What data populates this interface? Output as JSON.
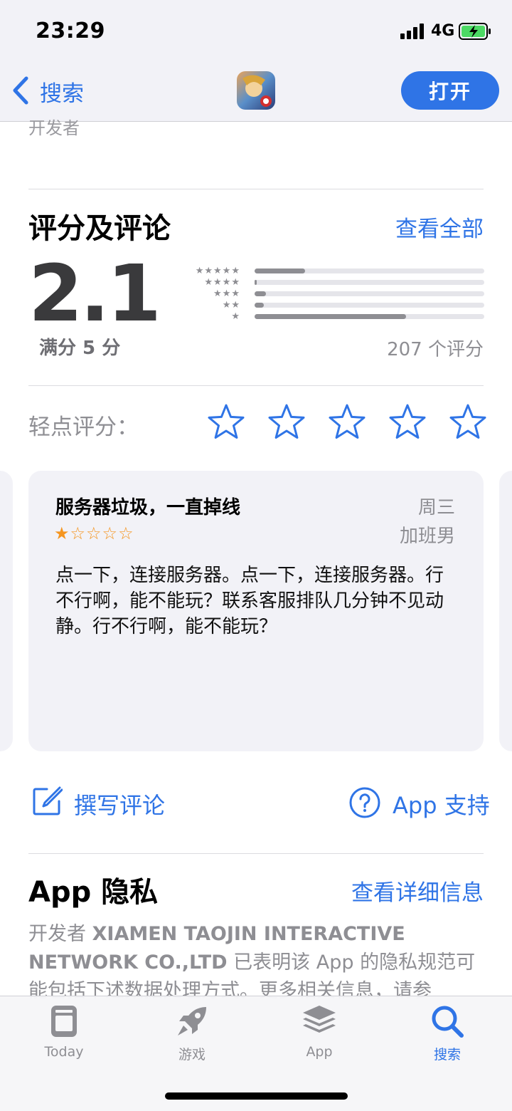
{
  "status": {
    "time": "23:29",
    "network": "4G"
  },
  "nav": {
    "back_label": "搜索",
    "open_label": "打开"
  },
  "top_cut_text": "开发者",
  "ratings": {
    "title": "评分及评论",
    "see_all": "查看全部",
    "average": "2.1",
    "out_of": "满分 5 分",
    "count": "207 个评分",
    "distribution": [
      {
        "stars": "★★★★★",
        "fraction": 0.22
      },
      {
        "stars": "★★★★",
        "fraction": 0.01
      },
      {
        "stars": "★★★",
        "fraction": 0.05
      },
      {
        "stars": "★★",
        "fraction": 0.04
      },
      {
        "stars": "★",
        "fraction": 0.66
      }
    ],
    "tap_to_rate": "轻点评分："
  },
  "review": {
    "title": "服务器垃圾，一直掉线",
    "date": "周三",
    "author": "加班男",
    "stars": "★☆☆☆☆",
    "body": "点一下，连接服务器。点一下，连接服务器。行不行啊，能不能玩？联系客服排队几分钟不见动静。行不行啊，能不能玩？"
  },
  "actions": {
    "write_review": "撰写评论",
    "app_support": "App 支持"
  },
  "privacy": {
    "title": "App 隐私",
    "details_link": "查看详细信息",
    "body_prefix": "开发者",
    "developer": "XIAMEN TAOJIN INTERACTIVE NETWORK CO.,LTD",
    "body_suffix": "已表明该 App 的隐私规范可能包括下述数据处理方式。更多相关信息，请参"
  },
  "tabs": [
    {
      "label": "Today",
      "icon": "today-icon"
    },
    {
      "label": "游戏",
      "icon": "rocket-icon"
    },
    {
      "label": "App",
      "icon": "apps-stack-icon"
    },
    {
      "label": "搜索",
      "icon": "search-icon"
    }
  ],
  "colors": {
    "accent": "#2f74e6",
    "review_star": "#f5951f",
    "battery_charge": "#4cd964"
  }
}
